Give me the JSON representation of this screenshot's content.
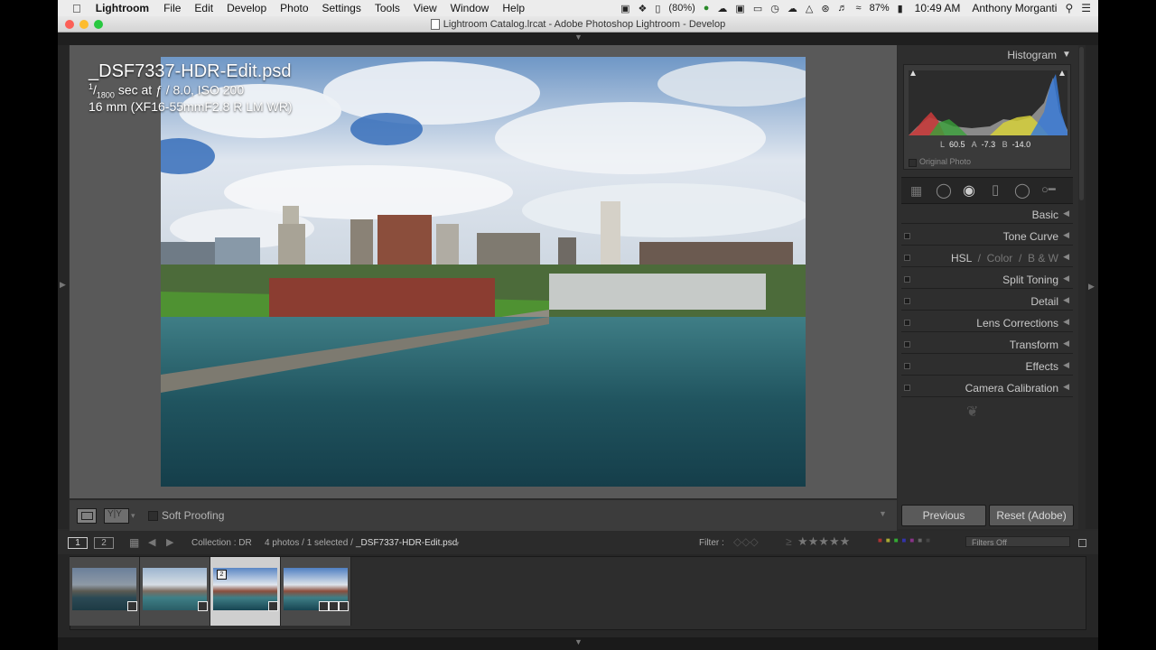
{
  "menubar": {
    "app_name": "Lightroom",
    "items": [
      "File",
      "Edit",
      "Develop",
      "Photo",
      "Settings",
      "Tools",
      "View",
      "Window",
      "Help"
    ],
    "battery_label": "(80%)",
    "battery_percent": "87%",
    "clock": "10:49 AM",
    "user": "Anthony Morganti"
  },
  "window": {
    "title": "Lightroom Catalog.lrcat - Adobe Photoshop Lightroom - Develop"
  },
  "photo_info": {
    "filename": "_DSF7337-HDR-Edit.psd",
    "exposure_numerator": "1",
    "exposure_denominator": "1800",
    "exposure_rest": " sec at ƒ / 8.0, ISO 200",
    "lens": "16 mm (XF16-55mmF2.8 R LM WR)"
  },
  "toolbar": {
    "soft_proofing": "Soft Proofing"
  },
  "right_panel": {
    "histogram_title": "Histogram",
    "lab_l_label": "L",
    "lab_l_value": "60.5",
    "lab_a_label": "A",
    "lab_a_value": "-7.3",
    "lab_b_label": "B",
    "lab_b_value": "-14.0",
    "original_photo": "Original Photo",
    "sections": {
      "basic": "Basic",
      "tone_curve": "Tone Curve",
      "hsl": "HSL",
      "color": "Color",
      "bw": "B & W",
      "split_toning": "Split Toning",
      "detail": "Detail",
      "lens_corrections": "Lens Corrections",
      "transform": "Transform",
      "effects": "Effects",
      "camera_calibration": "Camera Calibration"
    },
    "previous_button": "Previous",
    "reset_button": "Reset (Adobe)"
  },
  "infobar": {
    "view1": "1",
    "view2": "2",
    "collection": "Collection : DR",
    "photo_count": "4 photos / 1 selected /",
    "selected_file": "_DSF7337-HDR-Edit.psd",
    "filter_label": "Filter :",
    "filters_off": "Filters Off"
  },
  "filmstrip": {
    "stack_badge": "2",
    "selected_index": 3
  },
  "colors": {
    "accent_active": "#cfcfcf",
    "panel_bg": "#2e2e2e",
    "workspace_bg": "#595959"
  }
}
